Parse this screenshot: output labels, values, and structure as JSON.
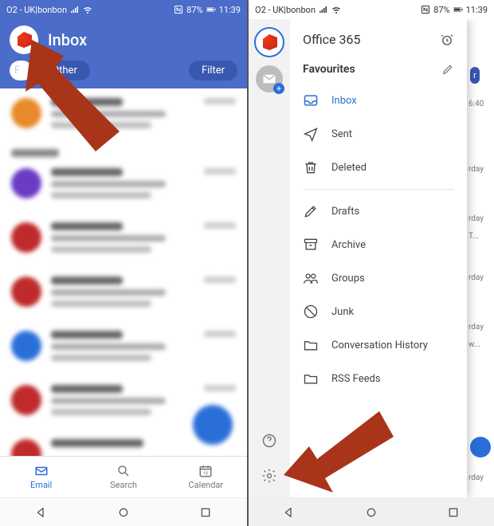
{
  "statusbar": {
    "carrier": "O2 - UK|bonbon",
    "battery": "87%",
    "time": "11:39"
  },
  "left": {
    "title": "Inbox",
    "tabs": {
      "focused": "Focused",
      "other": "Other",
      "filter": "Filter"
    },
    "nav": {
      "email": "Email",
      "search": "Search",
      "calendar": "Calendar"
    }
  },
  "right": {
    "account": "Office 365",
    "favourites": "Favourites",
    "folders": {
      "inbox": "Inbox",
      "sent": "Sent",
      "deleted": "Deleted",
      "drafts": "Drafts",
      "archive": "Archive",
      "groups": "Groups",
      "junk": "Junk",
      "conversation": "Conversation History",
      "rss": "RSS Feeds"
    },
    "peek": {
      "filter": "r",
      "time": "6:40",
      "day1": "rday",
      "day2": "rday",
      "day2b": "T...",
      "day3": "rday",
      "day4": "rday",
      "day4b": "w...",
      "day5": "rday"
    }
  }
}
